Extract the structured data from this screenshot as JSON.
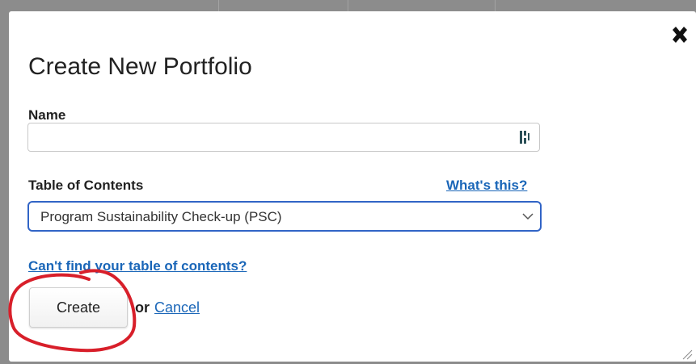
{
  "dialog": {
    "title": "Create New Portfolio",
    "close_icon": "close-x-icon",
    "name": {
      "label": "Name",
      "value": "",
      "placeholder": "",
      "badge_icon": "password-manager-icon"
    },
    "toc": {
      "label": "Table of Contents",
      "help_link": "What's this?",
      "selected_value": "Program Sustainability Check-up (PSC)",
      "chevron_icon": "chevron-down-icon"
    },
    "cant_find_link": "Can't find your table of contents?",
    "actions": {
      "create_label": "Create",
      "or_text": "or",
      "cancel_label": "Cancel"
    },
    "resize_icon": "resize-handle-icon"
  },
  "annotation": {
    "shape": "hand-drawn-circle",
    "color": "#d81f2a"
  },
  "colors": {
    "link": "#1a66b8",
    "select_border": "#3164c6",
    "backdrop": "#8c8c8c"
  }
}
